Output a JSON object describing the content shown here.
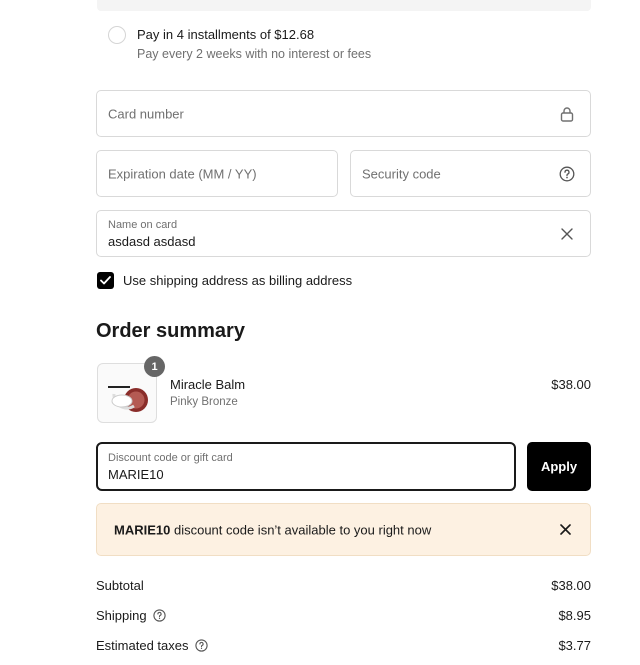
{
  "installments": {
    "title": "Pay in 4 installments of $12.68",
    "subtitle": "Pay every 2 weeks with no interest or fees"
  },
  "card": {
    "number_placeholder": "Card number",
    "expiration_placeholder": "Expiration date (MM / YY)",
    "security_placeholder": "Security code",
    "name_label": "Name on card",
    "name_value": "asdasd asdasd"
  },
  "billing": {
    "label": "Use shipping address as billing address",
    "checked": true
  },
  "summary": {
    "title": "Order summary",
    "product": {
      "quantity": "1",
      "name": "Miracle Balm",
      "variant": "Pinky Bronze",
      "price": "$38.00"
    },
    "discount": {
      "label": "Discount code or gift card",
      "value": "MARIE10",
      "apply_label": "Apply"
    },
    "alert": {
      "code": "MARIE10",
      "message": " discount code isn’t available to you right now"
    },
    "totals": {
      "subtotal_label": "Subtotal",
      "subtotal_value": "$38.00",
      "shipping_label": "Shipping",
      "shipping_value": "$8.95",
      "taxes_label": "Estimated taxes",
      "taxes_value": "$3.77"
    }
  },
  "colors": {
    "button_bg": "#000000",
    "alert_bg": "#fdf1e2",
    "muted_text": "#707070"
  },
  "icons": [
    "lock-icon",
    "question-circle-icon",
    "close-icon",
    "checkmark-icon",
    "info-circle-icon"
  ]
}
